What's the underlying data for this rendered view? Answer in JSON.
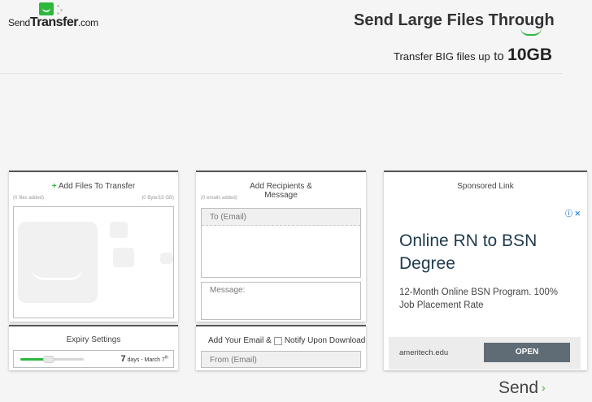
{
  "header": {
    "logo_prefix": "Send",
    "logo_bold": "Transfer",
    "logo_suffix": ".com",
    "headline": "Send Large Files Through",
    "headline_comma": ",",
    "subline_small": "Transfer BIG files up",
    "subline_mid": "to",
    "subline_big": "10GB"
  },
  "files": {
    "plus": "+",
    "title": "Add Files To Transfer",
    "files_added": "(0 files added)",
    "size_used": "(0 Byte/10 GB)"
  },
  "expiry": {
    "title": "Expiry Settings",
    "days": "7",
    "days_label": "days - March 7",
    "date_suffix": "th",
    "slider_fraction": 0.45
  },
  "recipients": {
    "title_line1": "Add Recipients &",
    "title_line2": "Message",
    "emails_added": "(0 emails added)",
    "to_placeholder": "To (Email)",
    "message_placeholder": "Message:"
  },
  "sender": {
    "add_email_label": "Add Your Email &",
    "notify_label": "Notify Upon Download",
    "from_placeholder": "From (Email)"
  },
  "ad": {
    "label": "Sponsored Link",
    "info_icons": "ⓘ ✕",
    "headline": "Online RN to BSN Degree",
    "description": "12-Month Online BSN Program. 100% Job Placement Rate",
    "domain": "ameritech.edu",
    "cta": "OPEN"
  },
  "send": {
    "label": "Send",
    "arrow": "›"
  },
  "colors": {
    "brand_green": "#2db83d",
    "ad_button": "#5f6b75",
    "ad_headline": "#1f3a4d"
  }
}
